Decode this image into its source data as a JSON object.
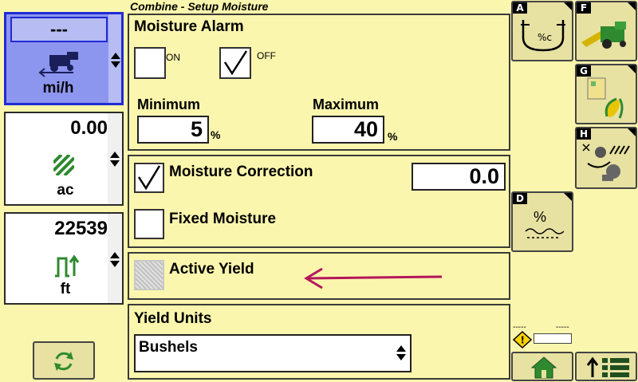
{
  "screen_title": "Combine - Setup Moisture",
  "left": {
    "speed_value": "---",
    "speed_unit": "mi/h",
    "area_value": "0.00",
    "area_unit": "ac",
    "distance_value": "22539",
    "distance_unit": "ft"
  },
  "moisture_alarm": {
    "title": "Moisture Alarm",
    "on_label": "ON",
    "off_label": "OFF",
    "on_checked": false,
    "off_checked": true,
    "minimum_label": "Minimum",
    "maximum_label": "Maximum",
    "minimum_value": "5",
    "maximum_value": "40",
    "percent_unit": "%"
  },
  "moisture_correction": {
    "label": "Moisture Correction",
    "checked": true,
    "value": "0.0",
    "fixed_label": "Fixed Moisture",
    "fixed_checked": false
  },
  "active_yield": {
    "label": "Active Yield",
    "disabled": true
  },
  "yield_units": {
    "title": "Yield Units",
    "selected": "Bushels"
  },
  "softkeys": {
    "a": "A",
    "d": "D",
    "f": "F",
    "g": "G",
    "h": "H",
    "a_text": "%c",
    "d_text": "%"
  },
  "status": {
    "dashes_left": "-----",
    "dashes_right": "-----"
  },
  "colors": {
    "background": "#fbf6ad",
    "selected_blue": "#1f2bd6",
    "arrow": "#b3175a",
    "green": "#2f8a2f"
  }
}
